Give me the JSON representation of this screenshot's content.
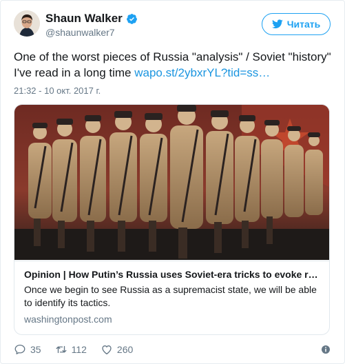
{
  "author": {
    "name": "Shaun Walker",
    "handle": "@shaunwalker7",
    "verified": true
  },
  "follow_button": {
    "label": "Читать",
    "icon": "twitter-bird-icon"
  },
  "tweet": {
    "text": "One of the worst pieces of Russia \"analysis\" / Soviet \"history\" I've read in a long time ",
    "link": "wapo.st/2ybxrYL?tid=ss…",
    "timestamp": "21:32 - 10 окт. 2017 г."
  },
  "card": {
    "title": "Opinion | How Putin’s Russia uses Soviet-era tricks to evoke r…",
    "description": "Once we begin to see Russia as a supremacist state, we will be able to identify its tactics.",
    "domain": "washingtonpost.com"
  },
  "actions": {
    "replies": "35",
    "retweets": "112",
    "likes": "260"
  },
  "colors": {
    "accent": "#1da1f2",
    "link": "#1b95e0",
    "muted": "#657786"
  }
}
